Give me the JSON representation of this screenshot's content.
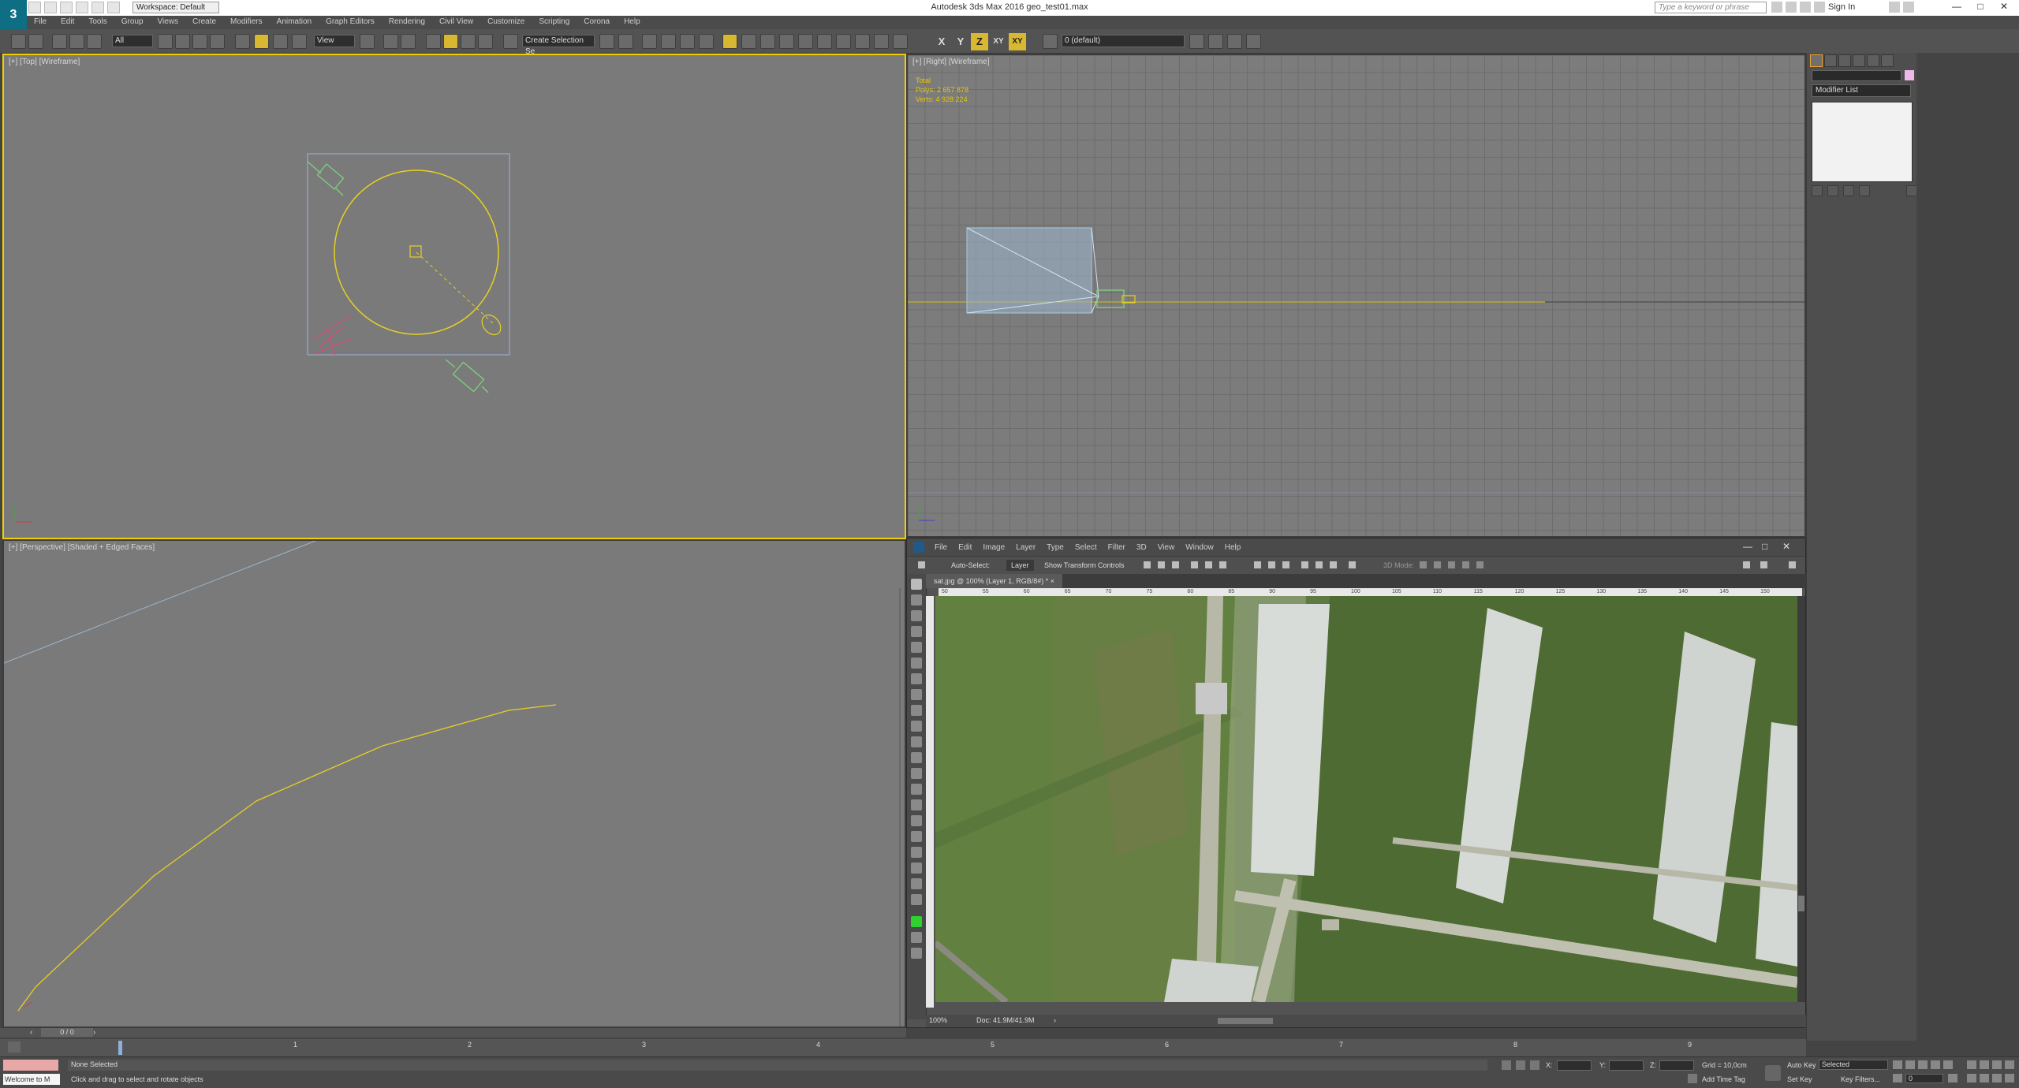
{
  "app": {
    "title": "Autodesk 3ds Max 2016     geo_test01.max",
    "logo": "3",
    "workspace": "Workspace: Default",
    "search_placeholder": "Type a keyword or phrase",
    "sign_in": "Sign In"
  },
  "menubar": [
    "File",
    "Edit",
    "Tools",
    "Group",
    "Views",
    "Create",
    "Modifiers",
    "Animation",
    "Graph Editors",
    "Rendering",
    "Civil View",
    "Customize",
    "Scripting",
    "Corona",
    "Help"
  ],
  "toolbar": {
    "selection_filter": "All",
    "ref_coord": "View",
    "named_selection": "Create Selection Se",
    "axis": [
      "X",
      "Y",
      "Z",
      "XY",
      "XY"
    ],
    "layer": "0 (default)"
  },
  "viewports": {
    "top": "[+] [Top] [Wireframe]",
    "right": "[+] [Right] [Wireframe]",
    "perspective": "[+] [Perspective] [Shaded + Edged Faces]",
    "stats": {
      "label": "Total",
      "polys_label": "Polys:",
      "polys": "2 657 878",
      "verts_label": "Verts:",
      "verts": "4 928 224"
    }
  },
  "command_panel": {
    "modifier_list": "Modifier List"
  },
  "photoshop": {
    "menu": [
      "File",
      "Edit",
      "Image",
      "Layer",
      "Type",
      "Select",
      "Filter",
      "3D",
      "View",
      "Window",
      "Help"
    ],
    "options": {
      "auto_select": "Auto-Select:",
      "layer": "Layer",
      "transform": "Show Transform Controls",
      "mode3d": "3D Mode:"
    },
    "tab": "sat.jpg @ 100% (Layer 1, RGB/8#) *",
    "zoom": "100%",
    "doc": "Doc: 41.9M/41.9M",
    "ruler": [
      "50",
      "55",
      "60",
      "65",
      "70",
      "75",
      "80",
      "85",
      "90",
      "95",
      "100",
      "105",
      "110",
      "115",
      "120",
      "125",
      "130",
      "135",
      "140",
      "145",
      "150"
    ]
  },
  "timeline": {
    "frame": "0 / 0",
    "ticks": [
      "1",
      "2",
      "3",
      "4",
      "5",
      "6",
      "7",
      "8",
      "9"
    ]
  },
  "status": {
    "maxscript": "Welcome to M",
    "selection": "None Selected",
    "prompt": "Click and drag to select and rotate objects",
    "x_label": "X:",
    "y_label": "Y:",
    "z_label": "Z:",
    "grid": "Grid = 10,0cm",
    "add_time_tag": "Add Time Tag",
    "auto_key": "Auto Key",
    "selected": "Selected",
    "set_key": "Set Key",
    "key_filters": "Key Filters...",
    "frame_field": "0"
  }
}
